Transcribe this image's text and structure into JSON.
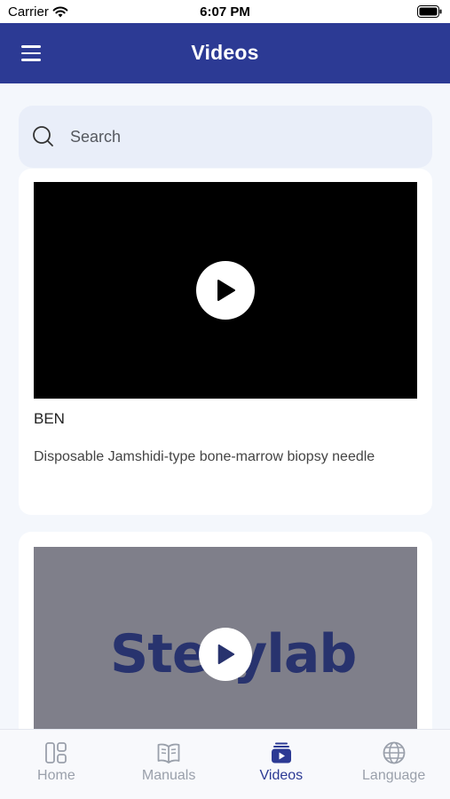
{
  "status_bar": {
    "carrier": "Carrier",
    "time": "6:07 PM"
  },
  "app_bar": {
    "title": "Videos",
    "menu_icon": "hamburger-menu-icon"
  },
  "search": {
    "placeholder": "Search",
    "icon": "search-icon"
  },
  "videos": [
    {
      "title": "BEN",
      "description": "Disposable Jamshidi-type bone-marrow biopsy needle"
    },
    {
      "thumbnail_text": "Sterylab"
    }
  ],
  "tabs": [
    {
      "label": "Home",
      "icon": "home-grid-icon",
      "active": false
    },
    {
      "label": "Manuals",
      "icon": "book-icon",
      "active": false
    },
    {
      "label": "Videos",
      "icon": "video-icon",
      "active": true
    },
    {
      "label": "Language",
      "icon": "globe-icon",
      "active": false
    }
  ],
  "colors": {
    "primary": "#2c3a94",
    "inactive": "#9aa0ab",
    "background": "#f4f7fc"
  }
}
